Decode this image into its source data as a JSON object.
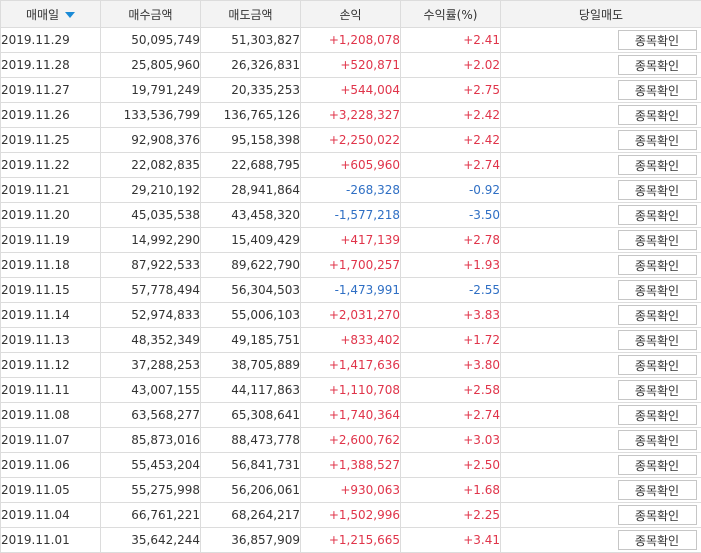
{
  "columns": {
    "date": "매매일",
    "buy": "매수금액",
    "sell": "매도금액",
    "pnl": "손익",
    "rate": "수익률(%)",
    "action": "당일매도"
  },
  "sort": {
    "column": "date",
    "direction": "descending"
  },
  "colors": {
    "positive": "#e0344a",
    "negative": "#2f6fc4",
    "sort_arrow": "#1a8ad6"
  },
  "rows": [
    {
      "date": "2019.11.29",
      "buy": "50,095,749",
      "sell": "51,303,827",
      "pnl": "+1,208,078",
      "rate": "+2.41",
      "sign": "pos",
      "button": "종목확인"
    },
    {
      "date": "2019.11.28",
      "buy": "25,805,960",
      "sell": "26,326,831",
      "pnl": "+520,871",
      "rate": "+2.02",
      "sign": "pos",
      "button": "종목확인"
    },
    {
      "date": "2019.11.27",
      "buy": "19,791,249",
      "sell": "20,335,253",
      "pnl": "+544,004",
      "rate": "+2.75",
      "sign": "pos",
      "button": "종목확인"
    },
    {
      "date": "2019.11.26",
      "buy": "133,536,799",
      "sell": "136,765,126",
      "pnl": "+3,228,327",
      "rate": "+2.42",
      "sign": "pos",
      "button": "종목확인"
    },
    {
      "date": "2019.11.25",
      "buy": "92,908,376",
      "sell": "95,158,398",
      "pnl": "+2,250,022",
      "rate": "+2.42",
      "sign": "pos",
      "button": "종목확인"
    },
    {
      "date": "2019.11.22",
      "buy": "22,082,835",
      "sell": "22,688,795",
      "pnl": "+605,960",
      "rate": "+2.74",
      "sign": "pos",
      "button": "종목확인"
    },
    {
      "date": "2019.11.21",
      "buy": "29,210,192",
      "sell": "28,941,864",
      "pnl": "-268,328",
      "rate": "-0.92",
      "sign": "neg",
      "button": "종목확인"
    },
    {
      "date": "2019.11.20",
      "buy": "45,035,538",
      "sell": "43,458,320",
      "pnl": "-1,577,218",
      "rate": "-3.50",
      "sign": "neg",
      "button": "종목확인"
    },
    {
      "date": "2019.11.19",
      "buy": "14,992,290",
      "sell": "15,409,429",
      "pnl": "+417,139",
      "rate": "+2.78",
      "sign": "pos",
      "button": "종목확인"
    },
    {
      "date": "2019.11.18",
      "buy": "87,922,533",
      "sell": "89,622,790",
      "pnl": "+1,700,257",
      "rate": "+1.93",
      "sign": "pos",
      "button": "종목확인"
    },
    {
      "date": "2019.11.15",
      "buy": "57,778,494",
      "sell": "56,304,503",
      "pnl": "-1,473,991",
      "rate": "-2.55",
      "sign": "neg",
      "button": "종목확인"
    },
    {
      "date": "2019.11.14",
      "buy": "52,974,833",
      "sell": "55,006,103",
      "pnl": "+2,031,270",
      "rate": "+3.83",
      "sign": "pos",
      "button": "종목확인"
    },
    {
      "date": "2019.11.13",
      "buy": "48,352,349",
      "sell": "49,185,751",
      "pnl": "+833,402",
      "rate": "+1.72",
      "sign": "pos",
      "button": "종목확인"
    },
    {
      "date": "2019.11.12",
      "buy": "37,288,253",
      "sell": "38,705,889",
      "pnl": "+1,417,636",
      "rate": "+3.80",
      "sign": "pos",
      "button": "종목확인"
    },
    {
      "date": "2019.11.11",
      "buy": "43,007,155",
      "sell": "44,117,863",
      "pnl": "+1,110,708",
      "rate": "+2.58",
      "sign": "pos",
      "button": "종목확인"
    },
    {
      "date": "2019.11.08",
      "buy": "63,568,277",
      "sell": "65,308,641",
      "pnl": "+1,740,364",
      "rate": "+2.74",
      "sign": "pos",
      "button": "종목확인"
    },
    {
      "date": "2019.11.07",
      "buy": "85,873,016",
      "sell": "88,473,778",
      "pnl": "+2,600,762",
      "rate": "+3.03",
      "sign": "pos",
      "button": "종목확인"
    },
    {
      "date": "2019.11.06",
      "buy": "55,453,204",
      "sell": "56,841,731",
      "pnl": "+1,388,527",
      "rate": "+2.50",
      "sign": "pos",
      "button": "종목확인"
    },
    {
      "date": "2019.11.05",
      "buy": "55,275,998",
      "sell": "56,206,061",
      "pnl": "+930,063",
      "rate": "+1.68",
      "sign": "pos",
      "button": "종목확인"
    },
    {
      "date": "2019.11.04",
      "buy": "66,761,221",
      "sell": "68,264,217",
      "pnl": "+1,502,996",
      "rate": "+2.25",
      "sign": "pos",
      "button": "종목확인"
    },
    {
      "date": "2019.11.01",
      "buy": "35,642,244",
      "sell": "36,857,909",
      "pnl": "+1,215,665",
      "rate": "+3.41",
      "sign": "pos",
      "button": "종목확인"
    }
  ]
}
